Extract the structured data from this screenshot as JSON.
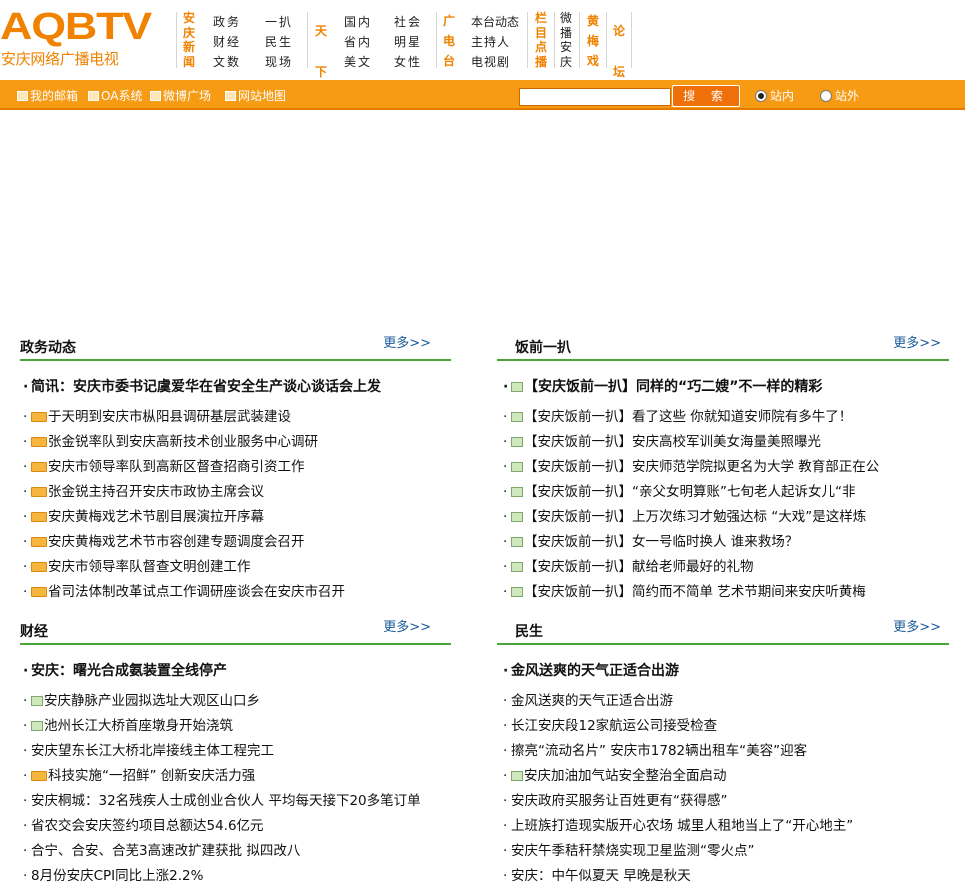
{
  "logo": {
    "mark": "AQBTV",
    "subtitle": "安庆网络广播电视"
  },
  "nav": [
    {
      "head": "安庆新闻",
      "links": [
        "政务",
        "财经",
        "文数"
      ],
      "links2": [
        "一扒",
        "民生",
        "现场"
      ]
    },
    {
      "head": "天下",
      "links": [
        "国内",
        "省内",
        "美文"
      ],
      "links2": [
        "社会",
        "明星",
        "女性"
      ]
    },
    {
      "head": "广电台",
      "links": [
        "本台动态",
        "主持人",
        "电视剧"
      ]
    },
    {
      "head": "栏目点播",
      "links": []
    },
    {
      "head": "微播安庆",
      "links": []
    },
    {
      "head": "黄梅戏",
      "links": []
    },
    {
      "head": "论坛",
      "links": []
    }
  ],
  "toolbar": {
    "mail": "我的邮箱",
    "oa": "OA系统",
    "weibo": "微博广场",
    "sitemap": "网站地图",
    "search_placeholder": "",
    "search_label": "搜 索",
    "radio_inside": "站内",
    "radio_outside": "站外"
  },
  "panels": {
    "zhengwu": {
      "title": "政务动态",
      "more": "更多>>",
      "headline": "简讯：安庆市委书记虞爱华在省安全生产谈心谈话会上发",
      "items": [
        "于天明到安庆市枞阳县调研基层武装建设",
        "张金锐率队到安庆高新技术创业服务中心调研",
        "安庆市领导率队到高新区督查招商引资工作",
        "张金锐主持召开安庆市政协主席会议",
        "安庆黄梅戏艺术节剧目展演拉开序幕",
        "安庆黄梅戏艺术节市容创建专题调度会召开",
        "安庆市领导率队督查文明创建工作",
        "省司法体制改革试点工作调研座谈会在安庆市召开"
      ]
    },
    "fanqian": {
      "title": "饭前一扒",
      "more": "更多>>",
      "headline": "【安庆饭前一扒】同样的“巧二嫂”不一样的精彩",
      "items": [
        "【安庆饭前一扒】看了这些  你就知道安师院有多牛了！",
        "【安庆饭前一扒】安庆高校军训美女海量美照曝光",
        "【安庆饭前一扒】安庆师范学院拟更名为大学  教育部正在公",
        "【安庆饭前一扒】“亲父女明算账”七旬老人起诉女儿“非",
        "【安庆饭前一扒】上万次练习才勉强达标  “大戏”是这样炼",
        "【安庆饭前一扒】女一号临时换人  谁来救场？",
        "【安庆饭前一扒】献给老师最好的礼物",
        "【安庆饭前一扒】简约而不简单  艺术节期间来安庆听黄梅"
      ]
    },
    "caijing": {
      "title": "财经",
      "more": "更多>>",
      "headline": "安庆：曙光合成氨装置全线停产",
      "items": [
        "安庆静脉产业园拟选址大观区山口乡",
        "池州长江大桥首座墩身开始浇筑",
        "安庆望东长江大桥北岸接线主体工程完工",
        "科技实施“一招鲜”  创新安庆活力强",
        "安庆桐城：32名残疾人士成创业合伙人  平均每天接下20多笔订单",
        "省农交会安庆签约项目总额达54.6亿元",
        "合宁、合安、合芜3高速改扩建获批  拟四改八",
        "8月份安庆CPI同比上涨2.2%"
      ]
    },
    "minsheng": {
      "title": "民生",
      "more": "更多>>",
      "headline": "金风送爽的天气正适合出游",
      "items": [
        "金风送爽的天气正适合出游",
        "长江安庆段12家航运公司接受检查",
        "擦亮“流动名片”  安庆市1782辆出租车“美容”迎客",
        "安庆加油加气站安全整治全面启动",
        "安庆政府买服务让百姓更有“获得感”",
        "上班族打造现实版开心农场  城里人租地当上了“开心地主”",
        "安庆午季秸秆禁烧实现卫星监测“零火点”",
        "安庆：中午似夏天  早晚是秋天"
      ]
    }
  }
}
